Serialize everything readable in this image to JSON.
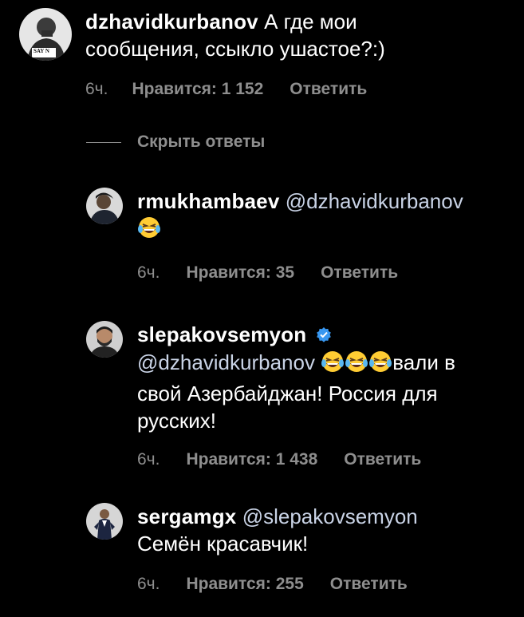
{
  "comments": [
    {
      "username": "dzhavidkurbanov",
      "text_line1": "А где мои",
      "text_line2": "сообщения, ссыкло ушастое?:)",
      "avatar_text": "SAY N",
      "time": "6ч.",
      "likes": "Нравится: 1 152",
      "reply": "Ответить"
    }
  ],
  "hide_replies": "Скрыть ответы",
  "replies": [
    {
      "username": "rmukhambaev",
      "mention": "@dzhavidkurbanov",
      "emoji": "😂",
      "time": "6ч.",
      "likes": "Нравится: 35",
      "reply": "Ответить"
    },
    {
      "username": "slepakovsemyon",
      "verified": true,
      "mention": "@dzhavidkurbanov",
      "emojis": "😂😂😂",
      "text_after_emoji": "вали в",
      "text_line2": "свой Азербайджан! Россия для",
      "text_line3": "русских!",
      "time": "6ч.",
      "likes": "Нравится: 1 438",
      "reply": "Ответить"
    },
    {
      "username": "sergamgx",
      "mention": "@slepakovsemyon",
      "text_line2": "Семён красавчик!",
      "time": "6ч.",
      "likes": "Нравится: 255",
      "reply": "Ответить"
    }
  ],
  "colors": {
    "background": "#000000",
    "text": "#ffffff",
    "secondary": "#8e8e8e",
    "mention": "#c9d3e6",
    "verified": "#3897f0"
  }
}
